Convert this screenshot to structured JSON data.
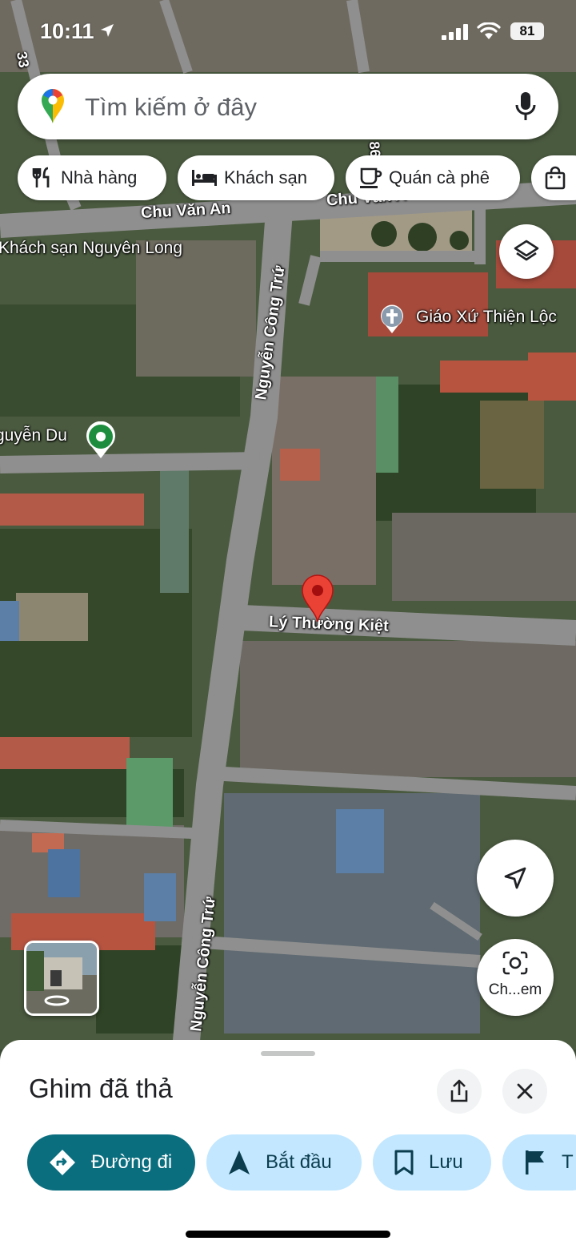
{
  "status_bar": {
    "time": "10:11",
    "battery": "81"
  },
  "search": {
    "placeholder": "Tìm kiếm ở đây"
  },
  "chips": [
    {
      "label": "Nhà hàng",
      "icon": "restaurant-icon"
    },
    {
      "label": "Khách sạn",
      "icon": "hotel-icon"
    },
    {
      "label": "Quán cà phê",
      "icon": "coffee-icon"
    },
    {
      "label": "",
      "icon": "shopping-bag-icon"
    }
  ],
  "map": {
    "roads": {
      "chu_van_an": "Chu Văn An",
      "chu_van_an_2": "Chu Văn A",
      "nguyen_cong_tru": "Nguyễn Công Trứ",
      "nguyen_cong_tru_2": "Nguyễn Công Trứ",
      "ly_thuong_kiet": "Lý Thường Kiệt",
      "road_33": "33",
      "road_86": "86"
    },
    "places": {
      "hotel": "Khách sạn Nguyên Long",
      "church": "Giáo Xứ Thiện Lộc",
      "school": "guyễn Du"
    },
    "lens_label": "Ch...em"
  },
  "sheet": {
    "title": "Ghim đã thả",
    "actions": {
      "directions": "Đường đi",
      "start": "Bắt đầu",
      "save": "Lưu",
      "flag": "T"
    }
  },
  "colors": {
    "primary_action": "#0b6e7f",
    "secondary_action": "#c2e7ff",
    "pin_red": "#ea4335",
    "place_green": "#1e8e3e"
  }
}
